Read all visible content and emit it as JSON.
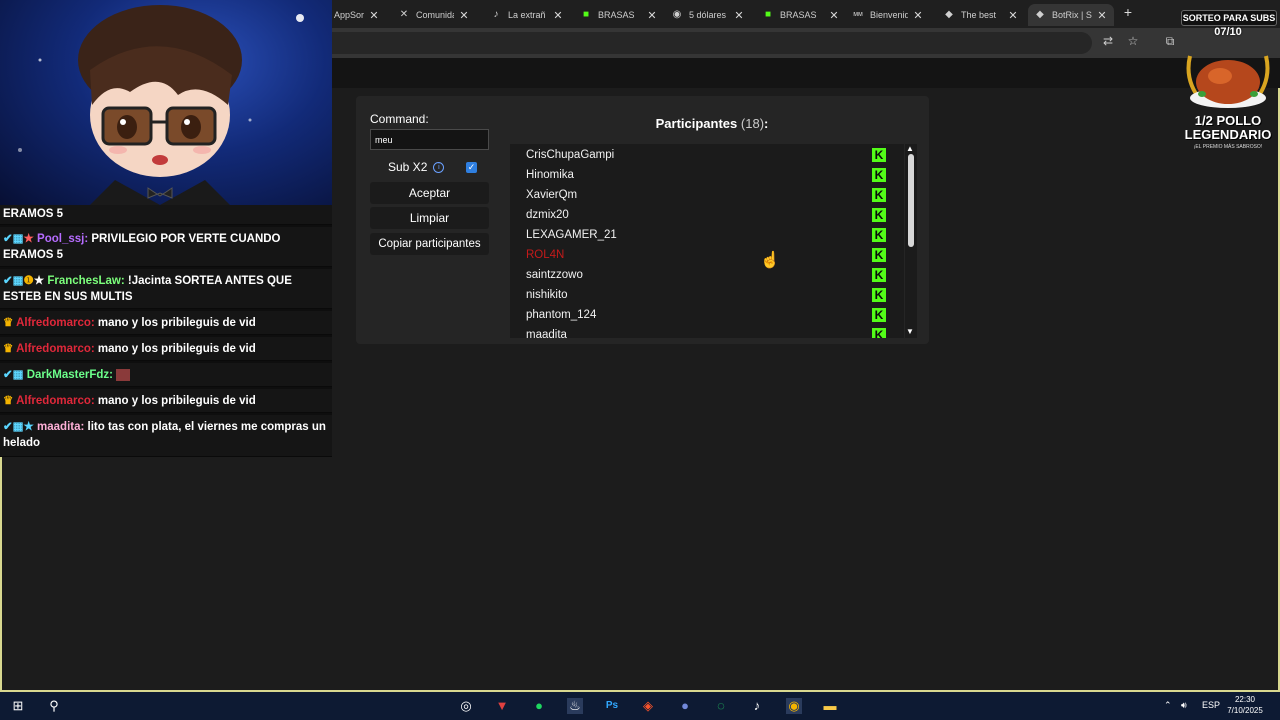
{
  "browser": {
    "tabs": [
      {
        "label": "AppSorteo",
        "icon": "appsorteo-icon"
      },
      {
        "label": "Comunidad",
        "icon": "x-logo-icon"
      },
      {
        "label": "La extrañ",
        "icon": "tiktok-icon"
      },
      {
        "label": "BRASAS",
        "icon": "kick-icon"
      },
      {
        "label": "5 dólares",
        "icon": "chrome-icon"
      },
      {
        "label": "BRASAS",
        "icon": "kick-icon"
      },
      {
        "label": "Bienvenid",
        "icon": "mm-icon"
      },
      {
        "label": "The best",
        "icon": "botrix-icon"
      },
      {
        "label": "BotRix | S",
        "icon": "botrix-icon",
        "active": true
      }
    ],
    "new_tab": "+"
  },
  "sorteo": {
    "command_label": "Command:",
    "command_value": "meu",
    "subx2_label": "Sub X2",
    "subx2_checked": true,
    "accept_label": "Aceptar",
    "clear_label": "Limpiar",
    "copy_label": "Copiar participantes",
    "participants_title": "Participantes",
    "participants_count": "(18)",
    "participants_colon": ":",
    "participants": [
      {
        "name": "CrisChupaGampi",
        "status": "ok"
      },
      {
        "name": "Hinomika",
        "status": "ok"
      },
      {
        "name": "XavierQm",
        "status": "ok"
      },
      {
        "name": "dzmix20",
        "status": "ok"
      },
      {
        "name": "LEXAGAMER_21",
        "status": "ok"
      },
      {
        "name": "ROL4N",
        "status": "banned"
      },
      {
        "name": "saintzzowo",
        "status": "ok"
      },
      {
        "name": "nishikito",
        "status": "ok"
      },
      {
        "name": "phantom_124",
        "status": "ok"
      },
      {
        "name": "maadita",
        "status": "ok"
      }
    ]
  },
  "chat": {
    "messages": [
      {
        "user": "",
        "text": "ERAMOS 5"
      },
      {
        "user": "Pool_ssj:",
        "text": "PRIVILEGIO POR VERTE CUANDO ERAMOS 5",
        "user_color": "#b66cff"
      },
      {
        "user": "FranchesLaw:",
        "text": "!Jacinta SORTEA ANTES QUE ESTEB EN SUS MULTIS",
        "user_color": "#7cff7c"
      },
      {
        "user": "Alfredomarco:",
        "text": "mano y los pribileguis de vid",
        "user_color": "#e0283a"
      },
      {
        "user": "Alfredomarco:",
        "text": "mano y los pribileguis de vid",
        "user_color": "#e0283a"
      },
      {
        "user": "DarkMasterFdz:",
        "text": "",
        "user_color": "#6cff8b"
      },
      {
        "user": "Alfredomarco:",
        "text": "mano y los pribileguis de vid",
        "user_color": "#e0283a"
      },
      {
        "user": "maadita:",
        "text": "lito tas con plata, el viernes me compras un helado",
        "user_color": "#ffb0d8"
      }
    ]
  },
  "giveaway": {
    "title": "SORTEO PARA SUBS",
    "count": "07/10",
    "prize": "1/2 POLLO LEGENDARIO",
    "prize_line1": "1/2 POLLO",
    "prize_line2": "LEGENDARIO",
    "tagline": "¡EL PREMIO MÁS SABROSO!"
  },
  "taskbar": {
    "language": "ESP",
    "time": "22:30",
    "date": "7/10/2025"
  },
  "colors": {
    "kick_green": "#53fc18",
    "banned_red": "#c41a1a",
    "panel_bg": "#252525",
    "taskbar_bg": "#0d1a33"
  }
}
